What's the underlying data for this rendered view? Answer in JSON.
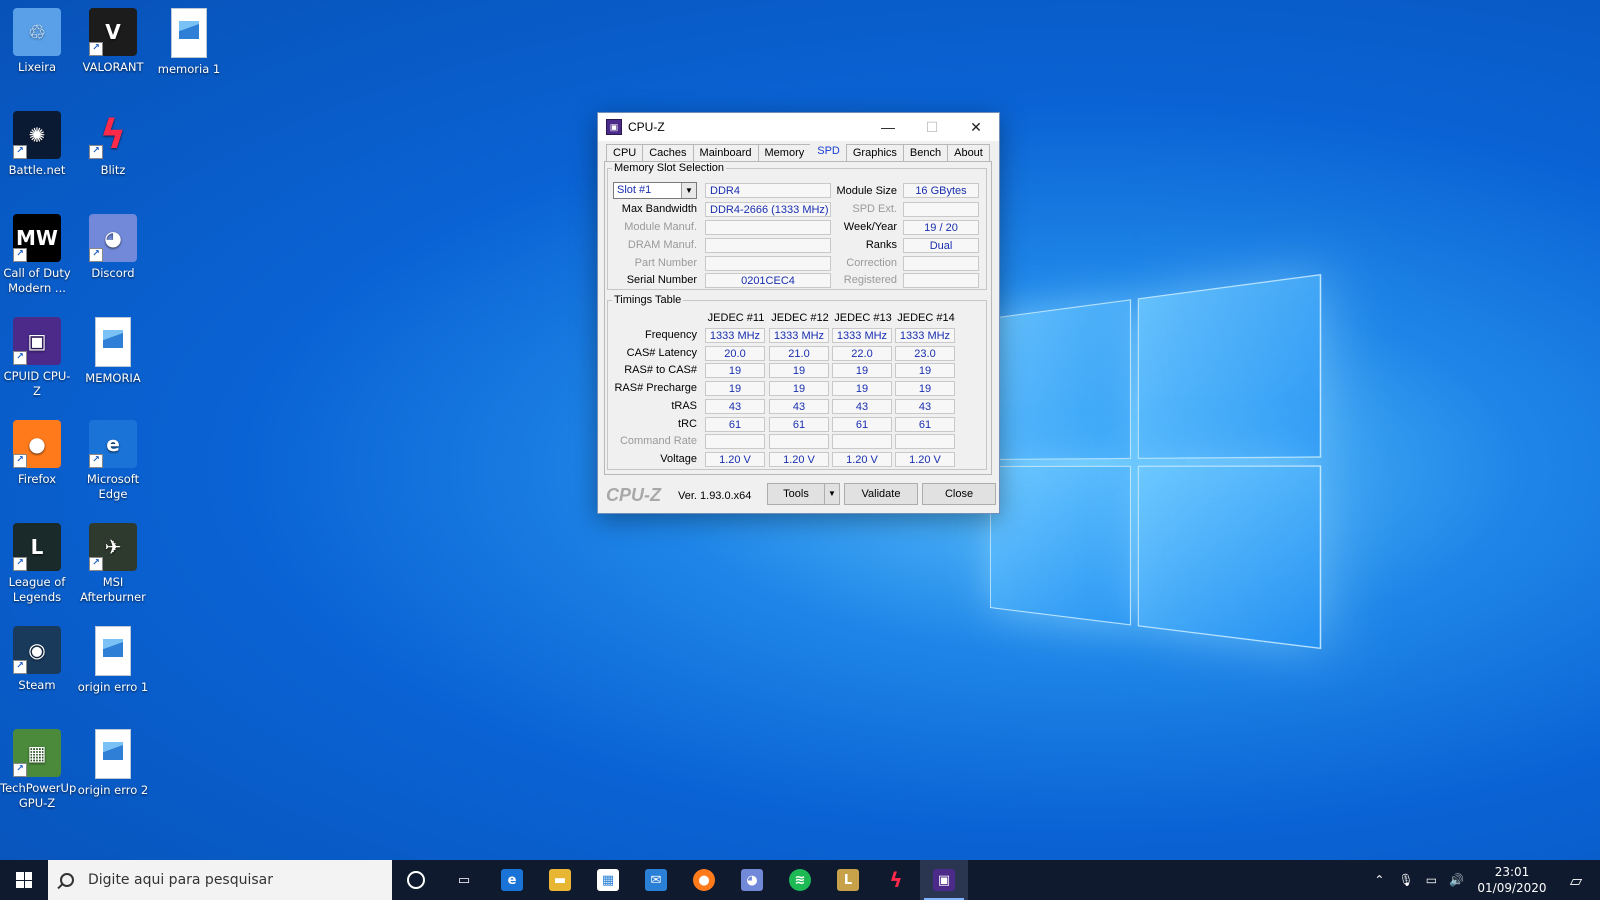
{
  "desktop": {
    "icons": [
      {
        "label": "Lixeira",
        "glyph": "♲",
        "color": "#5aa0e8"
      },
      {
        "label": "VALORANT",
        "glyph": "V",
        "color": "#1c1c1c"
      },
      {
        "label": "memoria 1",
        "glyph": "",
        "color": "#ffffff"
      },
      {
        "label": "Battle.net",
        "glyph": "✺",
        "color": "#0b1a33"
      },
      {
        "label": "Blitz",
        "glyph": "ϟ",
        "color": "transparent"
      },
      {
        "label": "Call of Duty Modern ...",
        "glyph": "MW",
        "color": "#000000"
      },
      {
        "label": "Discord",
        "glyph": "◕",
        "color": "#7289da"
      },
      {
        "label": "CPUID CPU-Z",
        "glyph": "▣",
        "color": "#4b2a8a"
      },
      {
        "label": "MEMORIA",
        "glyph": "",
        "color": "#ffffff"
      },
      {
        "label": "Firefox",
        "glyph": "●",
        "color": "#ff7a1a"
      },
      {
        "label": "Microsoft Edge",
        "glyph": "e",
        "color": "#1a73d6"
      },
      {
        "label": "League of Legends",
        "glyph": "L",
        "color": "#1a2a2a"
      },
      {
        "label": "MSI Afterburner",
        "glyph": "✈",
        "color": "#2d3a2d"
      },
      {
        "label": "Steam",
        "glyph": "◉",
        "color": "#1a3a5c"
      },
      {
        "label": "origin erro 1",
        "glyph": "",
        "color": "#ffffff"
      },
      {
        "label": "TechPowerUp GPU-Z",
        "glyph": "▦",
        "color": "#4a8a3a"
      },
      {
        "label": "origin erro 2",
        "glyph": "",
        "color": "#ffffff"
      }
    ]
  },
  "window": {
    "title": "CPU-Z",
    "tabs": [
      "CPU",
      "Caches",
      "Mainboard",
      "Memory",
      "SPD",
      "Graphics",
      "Bench",
      "About"
    ],
    "active_tab": "SPD",
    "slot_group": {
      "legend": "Memory Slot Selection",
      "slot": "Slot #1",
      "type": "DDR4",
      "max_bandwidth_label": "Max Bandwidth",
      "max_bandwidth": "DDR4-2666 (1333 MHz)",
      "module_manuf_label": "Module Manuf.",
      "module_manuf": "",
      "dram_manuf_label": "DRAM Manuf.",
      "dram_manuf": "",
      "part_number_label": "Part Number",
      "part_number": "",
      "serial_number_label": "Serial Number",
      "serial_number": "0201CEC4",
      "module_size_label": "Module Size",
      "module_size": "16 GBytes",
      "spd_ext_label": "SPD Ext.",
      "spd_ext": "",
      "week_year_label": "Week/Year",
      "week_year": "19 / 20",
      "ranks_label": "Ranks",
      "ranks": "Dual",
      "correction_label": "Correction",
      "correction": "",
      "registered_label": "Registered",
      "registered": ""
    },
    "timings": {
      "legend": "Timings Table",
      "columns": [
        "JEDEC #11",
        "JEDEC #12",
        "JEDEC #13",
        "JEDEC #14"
      ],
      "rows": [
        {
          "label": "Frequency",
          "values": [
            "1333 MHz",
            "1333 MHz",
            "1333 MHz",
            "1333 MHz"
          ],
          "disabled": false
        },
        {
          "label": "CAS# Latency",
          "values": [
            "20.0",
            "21.0",
            "22.0",
            "23.0"
          ],
          "disabled": false
        },
        {
          "label": "RAS# to CAS#",
          "values": [
            "19",
            "19",
            "19",
            "19"
          ],
          "disabled": false
        },
        {
          "label": "RAS# Precharge",
          "values": [
            "19",
            "19",
            "19",
            "19"
          ],
          "disabled": false
        },
        {
          "label": "tRAS",
          "values": [
            "43",
            "43",
            "43",
            "43"
          ],
          "disabled": false
        },
        {
          "label": "tRC",
          "values": [
            "61",
            "61",
            "61",
            "61"
          ],
          "disabled": false
        },
        {
          "label": "Command Rate",
          "values": [
            "",
            "",
            "",
            ""
          ],
          "disabled": true
        },
        {
          "label": "Voltage",
          "values": [
            "1.20 V",
            "1.20 V",
            "1.20 V",
            "1.20 V"
          ],
          "disabled": false
        }
      ]
    },
    "footer": {
      "logo": "CPU-Z",
      "version": "Ver. 1.93.0.x64",
      "tools_label": "Tools",
      "validate_label": "Validate",
      "close_label": "Close"
    }
  },
  "taskbar": {
    "search_placeholder": "Digite aqui para pesquisar",
    "apps": [
      {
        "name": "task-view",
        "glyph": "▭",
        "color": "transparent"
      },
      {
        "name": "edge",
        "glyph": "e",
        "color": "#1a73d6"
      },
      {
        "name": "file-explorer",
        "glyph": "▬",
        "color": "#e8b632"
      },
      {
        "name": "store",
        "glyph": "▦",
        "color": "#ffffff"
      },
      {
        "name": "mail",
        "glyph": "✉",
        "color": "#2a7fd6"
      },
      {
        "name": "firefox",
        "glyph": "●",
        "color": "#ff7a1a"
      },
      {
        "name": "discord",
        "glyph": "◕",
        "color": "#7289da"
      },
      {
        "name": "spotify",
        "glyph": "≋",
        "color": "#1db954"
      },
      {
        "name": "league",
        "glyph": "L",
        "color": "#c8a24a"
      },
      {
        "name": "blitz",
        "glyph": "ϟ",
        "color": "transparent"
      },
      {
        "name": "cpu-z",
        "glyph": "▣",
        "color": "#4b2a8a"
      }
    ],
    "time": "23:01",
    "date": "01/09/2020"
  }
}
